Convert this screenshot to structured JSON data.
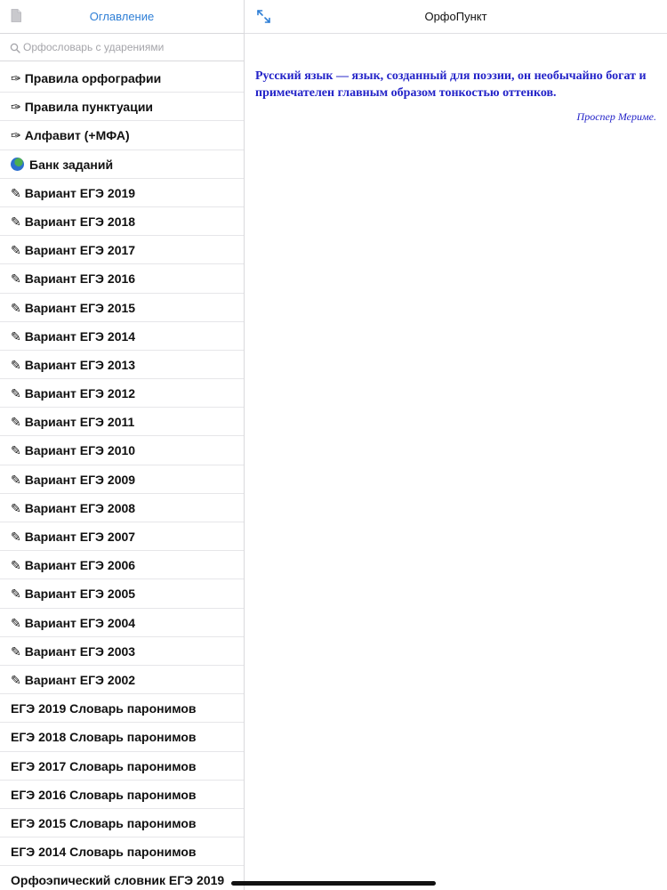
{
  "sidebar": {
    "title": "Оглавление",
    "search_placeholder": "Орфословарь с ударениями",
    "items": [
      {
        "glyph": "✑",
        "label": "Правила орфографии"
      },
      {
        "glyph": "✑",
        "label": "Правила пунктуации"
      },
      {
        "glyph": "✑",
        "label": "Алфавит (+МФА)"
      },
      {
        "glyph": "globe",
        "label": "Банк заданий"
      },
      {
        "glyph": "✎",
        "label": "Вариант ЕГЭ 2019"
      },
      {
        "glyph": "✎",
        "label": "Вариант ЕГЭ 2018"
      },
      {
        "glyph": "✎",
        "label": "Вариант ЕГЭ 2017"
      },
      {
        "glyph": "✎",
        "label": "Вариант ЕГЭ 2016"
      },
      {
        "glyph": "✎",
        "label": "Вариант ЕГЭ 2015"
      },
      {
        "glyph": "✎",
        "label": "Вариант ЕГЭ 2014"
      },
      {
        "glyph": "✎",
        "label": "Вариант ЕГЭ 2013"
      },
      {
        "glyph": "✎",
        "label": "Вариант ЕГЭ 2012"
      },
      {
        "glyph": "✎",
        "label": "Вариант ЕГЭ 2011"
      },
      {
        "glyph": "✎",
        "label": "Вариант ЕГЭ 2010"
      },
      {
        "glyph": "✎",
        "label": "Вариант ЕГЭ 2009"
      },
      {
        "glyph": "✎",
        "label": "Вариант ЕГЭ 2008"
      },
      {
        "glyph": "✎",
        "label": "Вариант ЕГЭ 2007"
      },
      {
        "glyph": "✎",
        "label": "Вариант ЕГЭ 2006"
      },
      {
        "glyph": "✎",
        "label": "Вариант ЕГЭ 2005"
      },
      {
        "glyph": "✎",
        "label": "Вариант ЕГЭ 2004"
      },
      {
        "glyph": "✎",
        "label": "Вариант ЕГЭ 2003"
      },
      {
        "glyph": "✎",
        "label": "Вариант ЕГЭ 2002"
      },
      {
        "glyph": "",
        "label": "ЕГЭ 2019 Словарь паронимов"
      },
      {
        "glyph": "",
        "label": "ЕГЭ 2018 Словарь паронимов"
      },
      {
        "glyph": "",
        "label": "ЕГЭ 2017 Словарь паронимов"
      },
      {
        "glyph": "",
        "label": "ЕГЭ 2016 Словарь паронимов"
      },
      {
        "glyph": "",
        "label": "ЕГЭ 2015 Словарь паронимов"
      },
      {
        "glyph": "",
        "label": "ЕГЭ 2014 Словарь паронимов"
      },
      {
        "glyph": "",
        "label": "Орфоэпический словник ЕГЭ 2019"
      }
    ]
  },
  "main": {
    "title": "ОрфоПункт",
    "quote": "Русский язык — язык, созданный для поэзии, он необычайно богат и примечателен главным образом тонкостью оттенков.",
    "author": "Проспер Мериме."
  },
  "icons": {
    "document": "document-icon",
    "search": "search-icon",
    "expand": "expand-arrows-icon",
    "globe": "globe-icon"
  },
  "colors": {
    "accent": "#2f7fd6",
    "quote": "#2323c8"
  }
}
